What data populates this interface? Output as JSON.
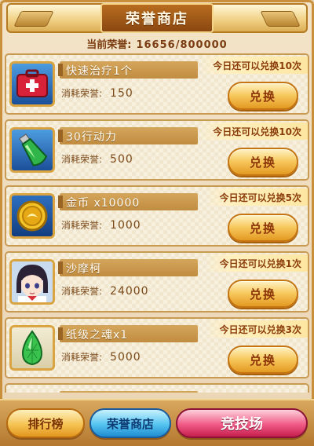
{
  "header": {
    "title": "荣誉商店",
    "honor_label": "当前荣誉:",
    "honor_value": "16656/800000"
  },
  "items": [
    {
      "name": "快速治疗1个",
      "cost_label": "消耗荣誉:",
      "cost": "150",
      "limit": "今日还可以兑换10次",
      "button": "兑换",
      "icon": "first-aid-kit-icon"
    },
    {
      "name": "30行动力",
      "cost_label": "消耗荣誉:",
      "cost": "500",
      "limit": "今日还可以兑换10次",
      "button": "兑换",
      "icon": "energy-potion-icon"
    },
    {
      "name": "金币 x10000",
      "cost_label": "消耗荣誉:",
      "cost": "1000",
      "limit": "今日还可以兑换5次",
      "button": "兑换",
      "icon": "gold-coin-icon"
    },
    {
      "name": "沙摩柯",
      "cost_label": "消耗荣誉:",
      "cost": "24000",
      "limit": "今日还可以兑换1次",
      "button": "兑换",
      "icon": "hero-portrait-icon"
    },
    {
      "name": "纸级之魂x1",
      "cost_label": "消耗荣誉:",
      "cost": "5000",
      "limit": "今日还可以兑换3次",
      "button": "兑换",
      "icon": "green-gem-icon"
    }
  ],
  "tabs": {
    "rank": "排行榜",
    "shop": "荣誉商店",
    "arena": "竞技场"
  }
}
